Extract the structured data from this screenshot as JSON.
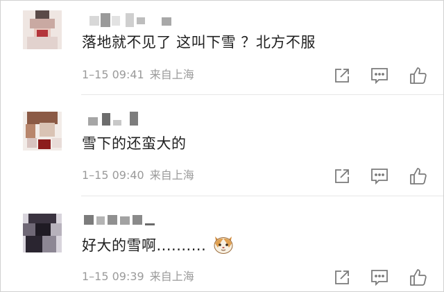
{
  "comments": [
    {
      "text": "落地就不见了 这叫下雪 ？北方不服",
      "time": "1–15 09:41",
      "location": "来自上海"
    },
    {
      "text": "雪下的还蛮大的",
      "time": "1–15 09:40",
      "location": "来自上海"
    },
    {
      "text": "好大的雪啊..........",
      "time": "1–15 09:39",
      "location": "来自上海",
      "emoji": "cat-face-icon"
    }
  ],
  "actions": [
    "share-icon",
    "comment-icon",
    "like-icon"
  ],
  "colors": {
    "text": "#1f1f1f",
    "meta": "#9a9a9a",
    "icon": "#7a7a7a",
    "divider": "#e6e6e6"
  }
}
